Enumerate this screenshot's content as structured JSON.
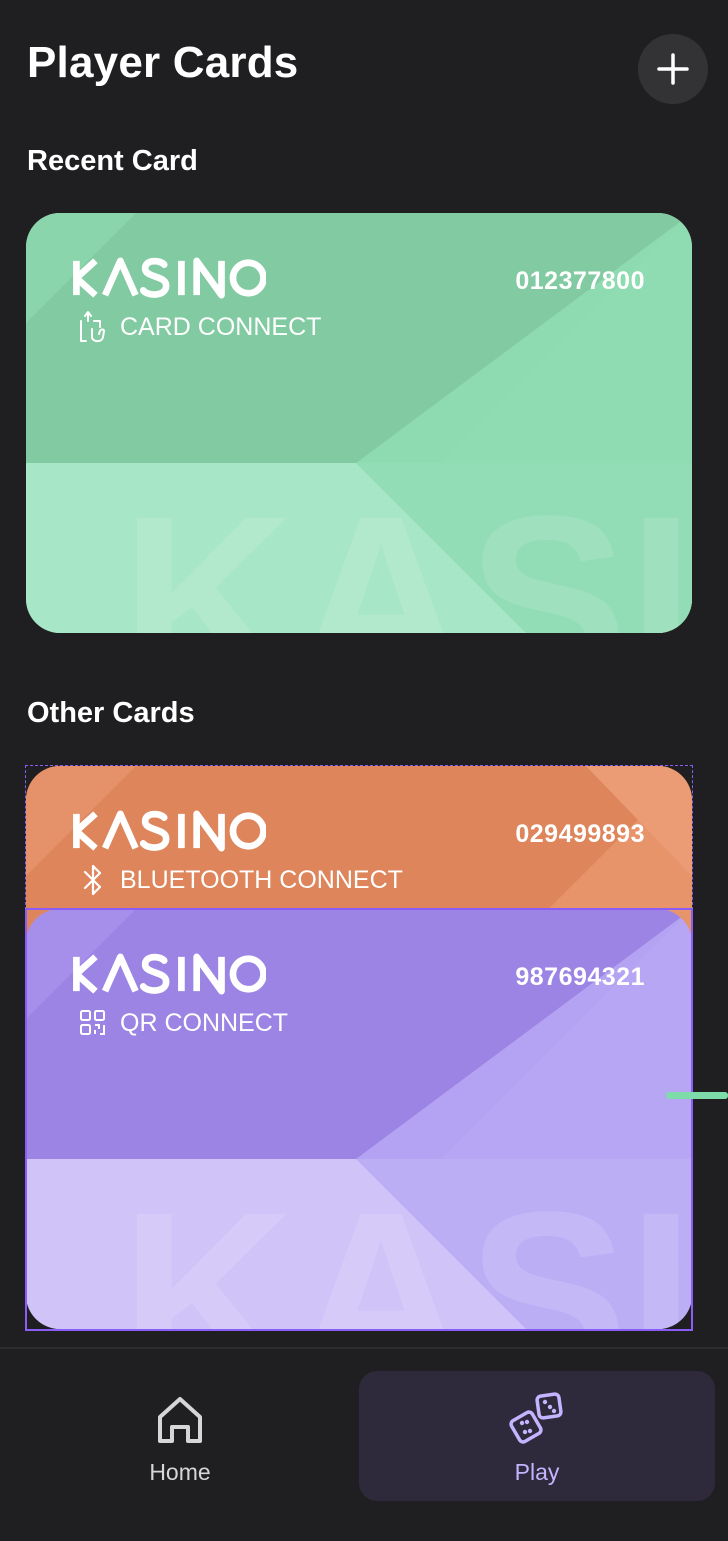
{
  "header": {
    "title": "Player Cards"
  },
  "sections": {
    "recent_title": "Recent Card",
    "other_title": "Other Cards"
  },
  "cards": [
    {
      "brand": "KASINO",
      "number": "012377800",
      "connect": "CARD CONNECT",
      "connect_icon": "tap-card-icon",
      "color": "#8fdbb3"
    },
    {
      "brand": "KASINO",
      "number": "029499893",
      "connect": "BLUETOOTH CONNECT",
      "connect_icon": "bluetooth-icon",
      "color": "#e8946b"
    },
    {
      "brand": "KASINO",
      "number": "987694321",
      "connect": "QR CONNECT",
      "connect_icon": "qr-code-icon",
      "color": "#b6a6f3"
    }
  ],
  "nav": {
    "home_label": "Home",
    "play_label": "Play"
  },
  "colors": {
    "background": "#1f1f21",
    "accent": "#8b5cf6",
    "play_active": "#c4b4ff"
  }
}
